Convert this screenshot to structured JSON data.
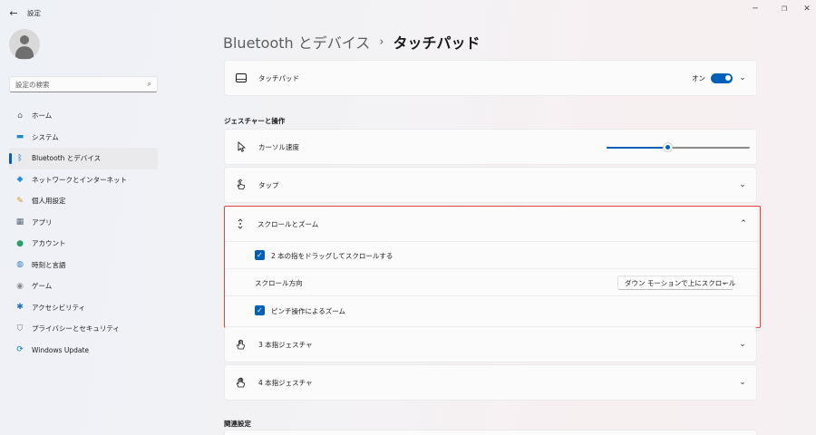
{
  "window": {
    "title": "設定",
    "back_glyph": "←",
    "minimize_glyph": "─",
    "maximize_glyph": "❐",
    "close_glyph": "✕"
  },
  "search": {
    "placeholder": "設定の検索"
  },
  "sidebar": {
    "items": [
      {
        "label": "ホーム",
        "icon": "home-icon",
        "glyph": "⌂",
        "color": "#6b6b6b"
      },
      {
        "label": "システム",
        "icon": "system-icon",
        "glyph": "▬",
        "color": "#1e88c8"
      },
      {
        "label": "Bluetooth とデバイス",
        "icon": "bluetooth-icon",
        "glyph": "ᛒ",
        "color": "#0067c0",
        "active": true
      },
      {
        "label": "ネットワークとインターネット",
        "icon": "wifi-icon",
        "glyph": "◆",
        "color": "#2a8ee0"
      },
      {
        "label": "個人用設定",
        "icon": "brush-icon",
        "glyph": "✎",
        "color": "#d98a1c"
      },
      {
        "label": "アプリ",
        "icon": "apps-icon",
        "glyph": "▦",
        "color": "#5b6a7a"
      },
      {
        "label": "アカウント",
        "icon": "account-icon",
        "glyph": "●",
        "color": "#27a06b"
      },
      {
        "label": "時刻と言語",
        "icon": "globe-icon",
        "glyph": "◍",
        "color": "#3b7fc2"
      },
      {
        "label": "ゲーム",
        "icon": "gamepad-icon",
        "glyph": "◉",
        "color": "#8a8a8a"
      },
      {
        "label": "アクセシビリティ",
        "icon": "accessibility-icon",
        "glyph": "✱",
        "color": "#1f6fc4"
      },
      {
        "label": "プライバシーとセキュリティ",
        "icon": "shield-icon",
        "glyph": "⛉",
        "color": "#6a6a6a"
      },
      {
        "label": "Windows Update",
        "icon": "update-icon",
        "glyph": "⟳",
        "color": "#0a78d4"
      }
    ]
  },
  "breadcrumb": {
    "parent": "Bluetooth とデバイス",
    "separator": "›",
    "current": "タッチパッド"
  },
  "touchpad": {
    "label": "タッチパッド",
    "toggle_text": "オン",
    "toggle_on": true
  },
  "gestures_section": {
    "title": "ジェスチャーと操作"
  },
  "cursor_speed": {
    "label": "カーソル速度",
    "value_fraction": 0.43
  },
  "tap": {
    "label": "タップ"
  },
  "scroll_zoom": {
    "label": "スクロールとズーム",
    "two_finger_scroll": {
      "label": "2 本の指をドラッグしてスクロールする",
      "checked": true
    },
    "scroll_direction": {
      "label": "スクロール方向",
      "value": "ダウン モーションで上にスクロール"
    },
    "pinch_zoom": {
      "label": "ピンチ操作によるズーム",
      "checked": true
    }
  },
  "three_finger": {
    "label": "3 本指ジェスチャ"
  },
  "four_finger": {
    "label": "4 本指ジェスチャ"
  },
  "related_section": {
    "title": "関連設定"
  },
  "glyphs": {
    "chevron_down": "⌄",
    "chevron_up": "⌃",
    "check": "✓"
  }
}
